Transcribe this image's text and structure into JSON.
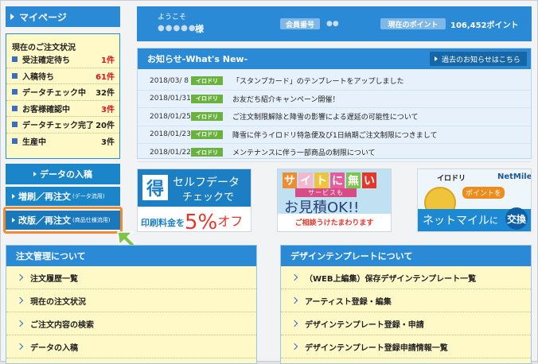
{
  "sidebar": {
    "title": "マイページ",
    "status": {
      "title": "現在のご注文状況",
      "items": [
        {
          "label": "受注確定待ち",
          "count": "1件",
          "alert": true
        },
        {
          "label": "入稿待ち",
          "count": "61件",
          "alert": true
        },
        {
          "label": "データチェック中",
          "count": "32件",
          "alert": false
        },
        {
          "label": "お客様確認中",
          "count": "3件",
          "alert": true
        },
        {
          "label": "データチェック完了",
          "count": "20件",
          "alert": false
        },
        {
          "label": "生産中",
          "count": "3件",
          "alert": false
        }
      ]
    },
    "nav": {
      "data_upload": "データの入稿",
      "reorder_main": "増刷／再注文",
      "reorder_sub": "(データ流用)",
      "revise_main": "改版／再注文",
      "revise_sub": "(商品仕様流用)"
    }
  },
  "header": {
    "welcome": "ようこそ",
    "username": "●●●●●",
    "honorific": "様",
    "member_no_label": "会員番号",
    "member_no_value": "●●",
    "points_label": "現在のポイント",
    "points_value": "106,452ポイント"
  },
  "news": {
    "title": "お知らせ-What's New-",
    "more": "過去のお知らせはこちら",
    "items": [
      {
        "date": "2018/03/ 8",
        "tag": "イロドリ",
        "text": "「スタンプカード」のテンプレートをアップしました"
      },
      {
        "date": "2018/01/31",
        "tag": "イロドリ",
        "text": "お友だち紹介キャンペーン開催！"
      },
      {
        "date": "2018/01/25",
        "tag": "イロドリ",
        "text": "ご注文制限解除と降雪の影響による遅延の可能性について"
      },
      {
        "date": "2018/01/23",
        "tag": "イロドリ",
        "text": "降雪に伴うイロドリ特急便及び1日納期ご注文制限につきまして"
      },
      {
        "date": "2018/01/22",
        "tag": "イロドリ",
        "text": "メンテナンスに伴う一部商品の制限について"
      }
    ]
  },
  "banners": {
    "selfcheck": {
      "badge": "得",
      "line1": "セルフデータ",
      "line2": "チェックで",
      "price_pre": "印刷料金を",
      "percent": "5%",
      "price_post": "オフ"
    },
    "estimate": {
      "chars": [
        "サ",
        "イ",
        "ト",
        "に",
        "無",
        "い"
      ],
      "sub": "サービスも",
      "main": "お見積OK!!",
      "bottom": "ご相談うけたまわります"
    },
    "netmile": {
      "brand1": "イロドリ",
      "brand2": "NetMile",
      "points": "ポイントを",
      "bar_text": "ネットマイル",
      "bar_ni": "に",
      "exchange": "交換"
    }
  },
  "orders_panel": {
    "title": "注文管理について",
    "links": [
      "注文履歴一覧",
      "現在の注文状況",
      "ご注文内容の検索",
      "データの入稿"
    ]
  },
  "design_panel": {
    "title": "デザインテンプレートについて",
    "links": [
      "（WEB上編集）保存デザインテンプレート一覧",
      "アーティスト登録・編集",
      "デザインテンプレート登録・申請",
      "デザインテンプレート登録申請情報一覧"
    ]
  },
  "colors": {
    "accent": "#2a8ad6",
    "alert": "#e0141e",
    "highlight": "#f28a2e",
    "tag": "#6ab23e",
    "panel_bg": "#fff9c8"
  }
}
